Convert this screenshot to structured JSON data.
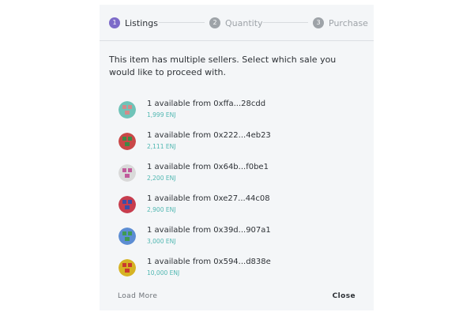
{
  "stepper": {
    "steps": [
      {
        "number": "1",
        "label": "Listings"
      },
      {
        "number": "2",
        "label": "Quantity"
      },
      {
        "number": "3",
        "label": "Purchase"
      }
    ]
  },
  "intro_text": "This item has multiple sellers. Select which sale you would like to proceed with.",
  "listings": [
    {
      "seller": "1 available from 0xffa...28cdd",
      "price": "1,999 ENJ",
      "avatar_colors": [
        "#6fc3b8",
        "#d38a8a"
      ]
    },
    {
      "seller": "1 available from 0x222...4eb23",
      "price": "2,111 ENJ",
      "avatar_colors": [
        "#c94848",
        "#3e8a46"
      ]
    },
    {
      "seller": "1 available from 0x64b...f0be1",
      "price": "2,200 ENJ",
      "avatar_colors": [
        "#d9d9d9",
        "#c05a9b"
      ]
    },
    {
      "seller": "1 available from 0xe27...44c08",
      "price": "2,900 ENJ",
      "avatar_colors": [
        "#c73d4e",
        "#3a4ea8"
      ]
    },
    {
      "seller": "1 available from 0x39d...907a1",
      "price": "3,000 ENJ",
      "avatar_colors": [
        "#5c8dd3",
        "#3f9a52"
      ]
    },
    {
      "seller": "1 available from 0x594...d838e",
      "price": "10,000 ENJ",
      "avatar_colors": [
        "#d6b324",
        "#c93a2e"
      ]
    }
  ],
  "footer": {
    "load_more": "Load More",
    "close": "Close"
  }
}
